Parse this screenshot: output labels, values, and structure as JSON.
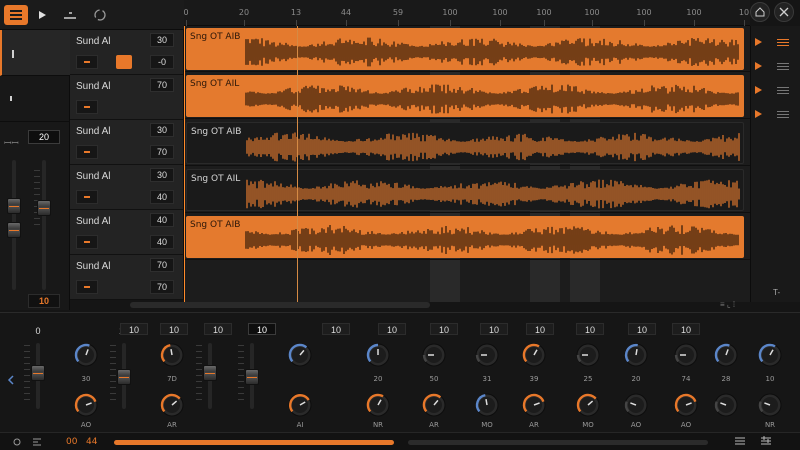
{
  "ruler": {
    "ticks": [
      "0",
      "20",
      "13",
      "44",
      "59",
      "100",
      "100",
      "100",
      "100",
      "100",
      "100",
      "10"
    ]
  },
  "master": {
    "value_top": "20",
    "value_bottom": "10"
  },
  "tracks": [
    {
      "name": "Sund Al",
      "value": "30",
      "value2": "-0",
      "clip": "Sng OT AIB",
      "active": true
    },
    {
      "name": "Sund Al",
      "value": "70",
      "value2": "",
      "clip": "Sng OT AIL",
      "active": true
    },
    {
      "name": "Sund Al",
      "value": "30",
      "value2": "70",
      "clip": "Sng OT AIB",
      "active": false
    },
    {
      "name": "Sund Al",
      "value": "30",
      "value2": "40",
      "clip": "Sng OT AIL",
      "active": false
    },
    {
      "name": "Sund Al",
      "value": "40",
      "value2": "40",
      "clip": "Sng OT AIB",
      "active": true
    },
    {
      "name": "Sund Al",
      "value": "70",
      "value2": "70",
      "clip": "",
      "active": false
    }
  ],
  "rightrail": {
    "bottom_label": "T-"
  },
  "mixer": {
    "faders": [
      {
        "value": "0"
      },
      {
        "value": "10"
      },
      {
        "value": "0"
      },
      {
        "value": "0"
      }
    ],
    "top_values": [
      "10",
      "10",
      "10",
      "10",
      "10",
      "10",
      "10",
      "10",
      "10",
      "10",
      "10",
      "10"
    ],
    "knob_labels_mid": [
      "30",
      "7D",
      "",
      "20",
      "50",
      "31",
      "39",
      "25",
      "20",
      "74",
      "28",
      "10"
    ],
    "knob_labels_bottom": [
      "AO",
      "AR",
      "AI",
      "NR",
      "AR",
      "MO",
      "AR",
      "MO",
      "AO",
      "AO",
      "",
      "NR"
    ]
  },
  "status": {
    "left_a": "00",
    "left_b": "44"
  },
  "colors": {
    "accent": "#e8782a",
    "clip_on": "#e47a2e",
    "knob_blue": "#5b86c9"
  }
}
